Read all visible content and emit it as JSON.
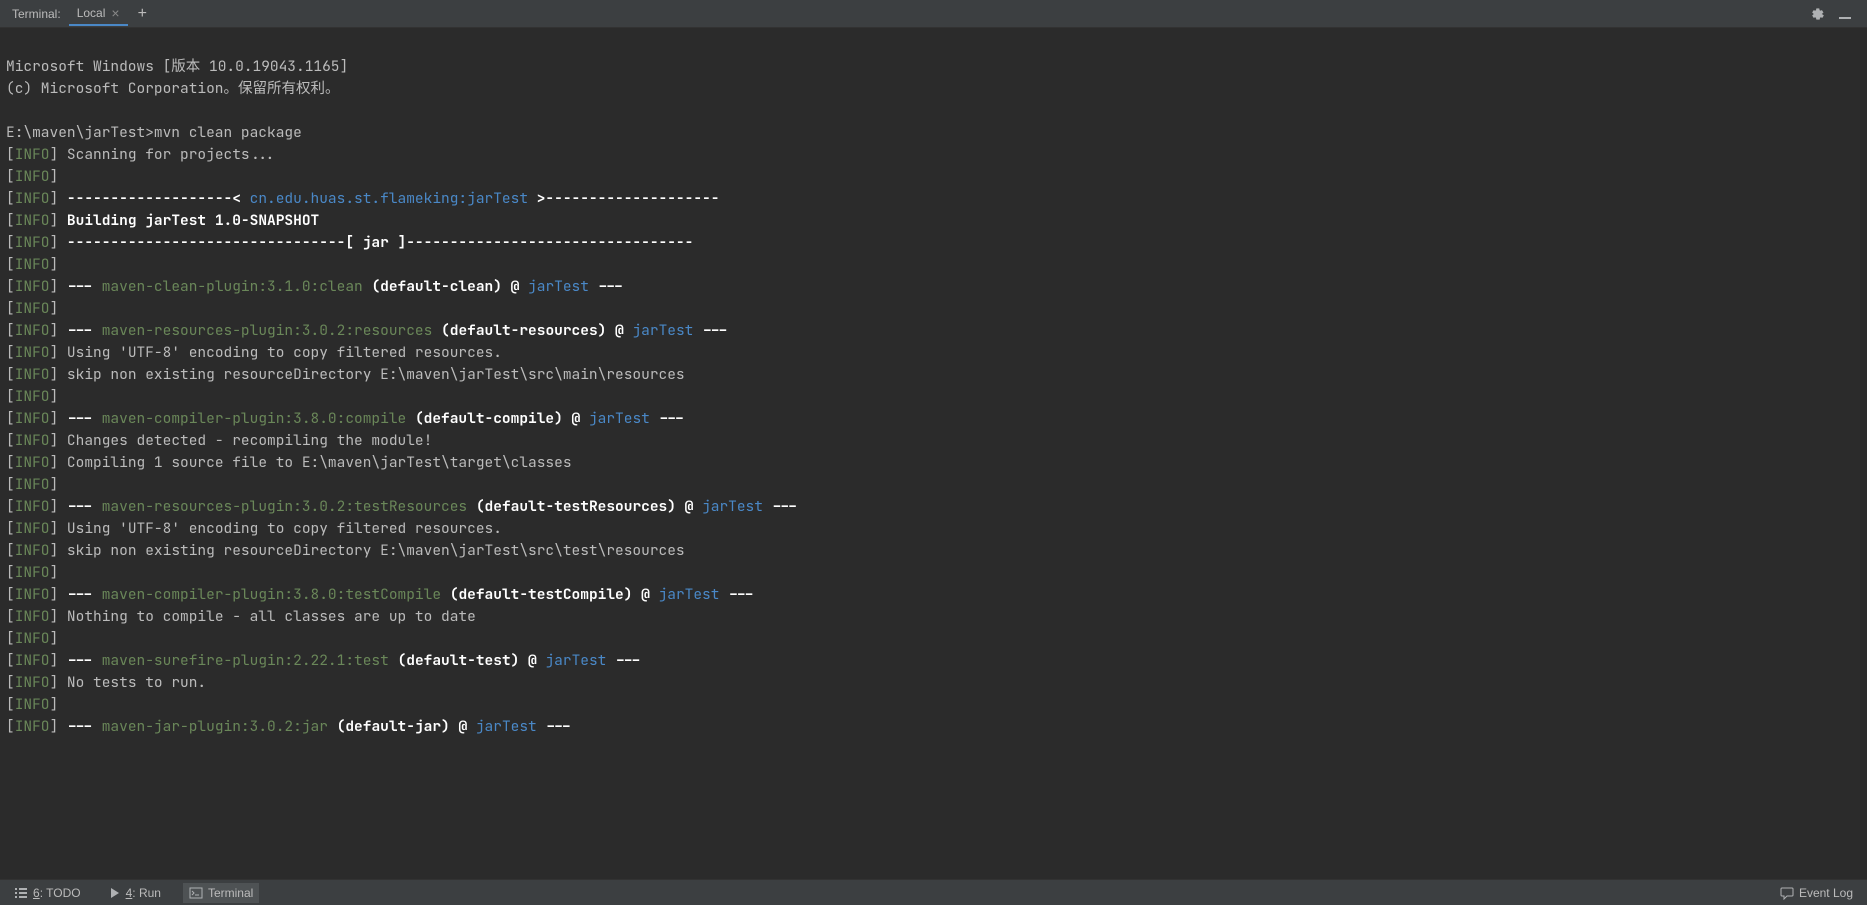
{
  "topBar": {
    "label": "Terminal:",
    "tab": "Local"
  },
  "terminal": {
    "os_line1": "Microsoft Windows [版本 10.0.19043.1165]",
    "os_line2": "(c) Microsoft Corporation。保留所有权利。",
    "prompt": "E:\\maven\\jarTest>mvn clean package",
    "info_label": "INFO",
    "scanning": "Scanning for projects...",
    "dashes_open": "-------------------< ",
    "groupId": "cn.edu.huas.st.flameking:jarTest",
    "dashes_close": " >--------------------",
    "building": "Building jarTest 1.0-SNAPSHOT",
    "jar_line": "--------------------------------[ jar ]---------------------------------",
    "dash3": "--- ",
    "dash3_end": " ---",
    "clean_plugin": "maven-clean-plugin:3.1.0:clean",
    "clean_goal": "(default-clean)",
    "at": " @ ",
    "project": "jarTest",
    "resources_plugin": "maven-resources-plugin:3.0.2:resources",
    "resources_goal": "(default-resources)",
    "utf8": "Using 'UTF-8' encoding to copy filtered resources.",
    "skip_main": "skip non existing resourceDirectory E:\\maven\\jarTest\\src\\main\\resources",
    "compiler_plugin": "maven-compiler-plugin:3.8.0:compile",
    "compiler_goal": "(default-compile)",
    "changes": "Changes detected - recompiling the module!",
    "compiling": "Compiling 1 source file to E:\\maven\\jarTest\\target\\classes",
    "testres_plugin": "maven-resources-plugin:3.0.2:testResources",
    "testres_goal": "(default-testResources)",
    "skip_test": "skip non existing resourceDirectory E:\\maven\\jarTest\\src\\test\\resources",
    "testcompile_plugin": "maven-compiler-plugin:3.8.0:testCompile",
    "testcompile_goal": "(default-testCompile)",
    "nothing": "Nothing to compile - all classes are up to date",
    "surefire_plugin": "maven-surefire-plugin:2.22.1:test",
    "surefire_goal": "(default-test)",
    "notests": "No tests to run.",
    "jar_plugin": "maven-jar-plugin:3.0.2:jar",
    "jar_goal": "(default-jar)"
  },
  "bottomBar": {
    "todo_key": "6",
    "todo_label": ": TODO",
    "run_key": "4",
    "run_label": ": Run",
    "terminal": "Terminal",
    "eventLog": "Event Log"
  }
}
